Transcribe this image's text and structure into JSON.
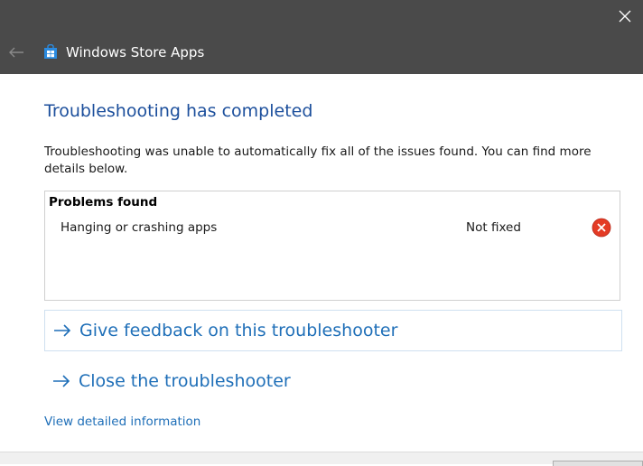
{
  "window": {
    "title": "Windows Store Apps",
    "back_icon": "back-arrow-icon",
    "close_icon": "close-icon",
    "app_icon": "store-bag-icon"
  },
  "content": {
    "heading": "Troubleshooting has completed",
    "description": "Troubleshooting was unable to automatically fix all of the issues found. You can find more details below.",
    "problems": {
      "title": "Problems found",
      "items": [
        {
          "name": "Hanging or crashing apps",
          "status": "Not fixed",
          "status_icon": "error-icon"
        }
      ]
    },
    "links": [
      {
        "label": "Give feedback on this troubleshooter",
        "icon": "arrow-right-icon"
      },
      {
        "label": "Close the troubleshooter",
        "icon": "arrow-right-icon"
      }
    ],
    "detail_link": "View detailed information"
  },
  "colors": {
    "titlebar": "#4a4a4a",
    "heading": "#1c4f9c",
    "link": "#1f6fb8",
    "error": "#e43b25"
  }
}
